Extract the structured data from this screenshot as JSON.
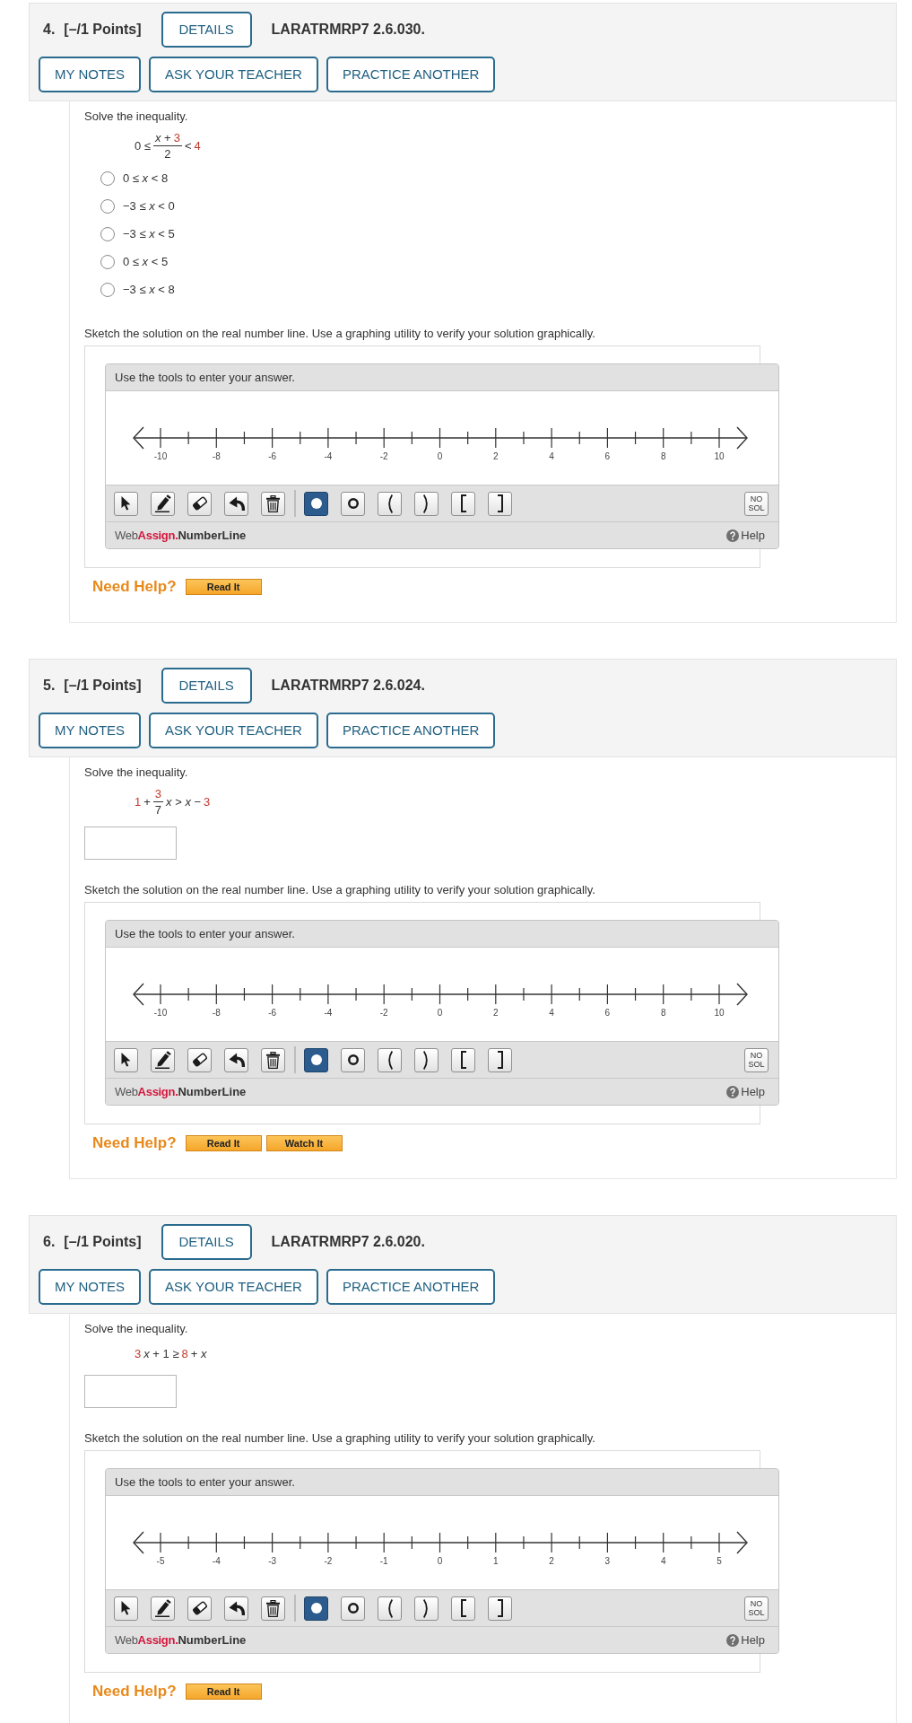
{
  "questions": [
    {
      "number": "4.",
      "points": "[–/1 Points]",
      "details_button": "DETAILS",
      "code": "LARATRMRP7 2.6.030.",
      "actions": [
        "MY NOTES",
        "ASK YOUR TEACHER",
        "PRACTICE ANOTHER"
      ],
      "instruction": "Solve the inequality.",
      "expression": [
        {
          "kind": "text",
          "text": "0 ≤"
        },
        {
          "kind": "fraction",
          "numerator": [
            {
              "kind": "text",
              "text": "*x* +"
            },
            {
              "kind": "highlight",
              "text": "3"
            }
          ],
          "denominator": [
            {
              "kind": "text",
              "text": "2"
            }
          ]
        },
        {
          "kind": "text",
          "text": "<"
        },
        {
          "kind": "highlight",
          "text": "4"
        }
      ],
      "answer": {
        "kind": "choices",
        "options": [
          {
            "text": "0 ≤ *x* < 8",
            "selected": false
          },
          {
            "text": "−3 ≤ *x* < 0",
            "selected": false
          },
          {
            "text": "−3 ≤ *x* < 5",
            "selected": false
          },
          {
            "text": "0 ≤ *x* < 5",
            "selected": false
          },
          {
            "text": "−3 ≤ *x* < 8",
            "selected": false
          }
        ]
      },
      "sketch_instruction": "Sketch the solution on the real number line. Use a graphing utility to verify your solution graphically.",
      "number_line": {
        "prompt": "Use the tools to enter your answer.",
        "tick_labels": [
          "-10",
          "-8",
          "-6",
          "-4",
          "-2",
          "0",
          "2",
          "4",
          "6",
          "8",
          "10"
        ],
        "edit_tools": [
          {
            "kind": "select",
            "selected": false
          },
          {
            "kind": "pencil",
            "selected": false
          },
          {
            "kind": "eraser",
            "selected": false
          },
          {
            "kind": "undo",
            "selected": false
          },
          {
            "kind": "trash",
            "selected": false
          }
        ],
        "marker_tools": [
          {
            "kind": "closed_dot",
            "selected": true
          },
          {
            "kind": "open_dot",
            "selected": false
          },
          {
            "kind": "left_paren",
            "selected": false
          },
          {
            "kind": "right_paren",
            "selected": false
          },
          {
            "kind": "left_bracket",
            "selected": false
          },
          {
            "kind": "right_bracket",
            "selected": false
          }
        ],
        "no_solution": "NO SOL",
        "logo": [
          {
            "kind": "light",
            "text": "Web"
          },
          {
            "kind": "accent",
            "text": "Assign"
          },
          {
            "kind": "accent",
            "text": "."
          },
          {
            "kind": "strong",
            "text": "NumberLine"
          }
        ],
        "help": "Help"
      },
      "need_help": {
        "label": "Need Help?",
        "buttons": [
          "Read It"
        ]
      }
    },
    {
      "number": "5.",
      "points": "[–/1 Points]",
      "details_button": "DETAILS",
      "code": "LARATRMRP7 2.6.024.",
      "actions": [
        "MY NOTES",
        "ASK YOUR TEACHER",
        "PRACTICE ANOTHER"
      ],
      "instruction": "Solve the inequality.",
      "expression": [
        {
          "kind": "highlight",
          "text": "1"
        },
        {
          "kind": "text",
          "text": "+"
        },
        {
          "kind": "fraction",
          "numerator": [
            {
              "kind": "highlight",
              "text": "3"
            }
          ],
          "denominator": [
            {
              "kind": "text",
              "text": "7"
            }
          ]
        },
        {
          "kind": "text",
          "text": "*x* > *x* −"
        },
        {
          "kind": "highlight",
          "text": "3"
        }
      ],
      "answer": {
        "kind": "input"
      },
      "sketch_instruction": "Sketch the solution on the real number line. Use a graphing utility to verify your solution graphically.",
      "number_line": {
        "prompt": "Use the tools to enter your answer.",
        "tick_labels": [
          "-10",
          "-8",
          "-6",
          "-4",
          "-2",
          "0",
          "2",
          "4",
          "6",
          "8",
          "10"
        ],
        "edit_tools": [
          {
            "kind": "select",
            "selected": false
          },
          {
            "kind": "pencil",
            "selected": false
          },
          {
            "kind": "eraser",
            "selected": false
          },
          {
            "kind": "undo",
            "selected": false
          },
          {
            "kind": "trash",
            "selected": false
          }
        ],
        "marker_tools": [
          {
            "kind": "closed_dot",
            "selected": true
          },
          {
            "kind": "open_dot",
            "selected": false
          },
          {
            "kind": "left_paren",
            "selected": false
          },
          {
            "kind": "right_paren",
            "selected": false
          },
          {
            "kind": "left_bracket",
            "selected": false
          },
          {
            "kind": "right_bracket",
            "selected": false
          }
        ],
        "no_solution": "NO SOL",
        "logo": [
          {
            "kind": "light",
            "text": "Web"
          },
          {
            "kind": "accent",
            "text": "Assign"
          },
          {
            "kind": "accent",
            "text": "."
          },
          {
            "kind": "strong",
            "text": "NumberLine"
          }
        ],
        "help": "Help"
      },
      "need_help": {
        "label": "Need Help?",
        "buttons": [
          "Read It",
          "Watch It"
        ]
      }
    },
    {
      "number": "6.",
      "points": "[–/1 Points]",
      "details_button": "DETAILS",
      "code": "LARATRMRP7 2.6.020.",
      "actions": [
        "MY NOTES",
        "ASK YOUR TEACHER",
        "PRACTICE ANOTHER"
      ],
      "instruction": "Solve the inequality.",
      "expression": [
        {
          "kind": "highlight",
          "text": "3"
        },
        {
          "kind": "text",
          "text": "*x* + 1 ≥"
        },
        {
          "kind": "highlight",
          "text": "8"
        },
        {
          "kind": "text",
          "text": "+ *x*"
        }
      ],
      "answer": {
        "kind": "input"
      },
      "sketch_instruction": "Sketch the solution on the real number line. Use a graphing utility to verify your solution graphically.",
      "number_line": {
        "prompt": "Use the tools to enter your answer.",
        "tick_labels": [
          "-5",
          "-4",
          "-3",
          "-2",
          "-1",
          "0",
          "1",
          "2",
          "3",
          "4",
          "5"
        ],
        "edit_tools": [
          {
            "kind": "select",
            "selected": false
          },
          {
            "kind": "pencil",
            "selected": false
          },
          {
            "kind": "eraser",
            "selected": false
          },
          {
            "kind": "undo",
            "selected": false
          },
          {
            "kind": "trash",
            "selected": false
          }
        ],
        "marker_tools": [
          {
            "kind": "closed_dot",
            "selected": true
          },
          {
            "kind": "open_dot",
            "selected": false
          },
          {
            "kind": "left_paren",
            "selected": false
          },
          {
            "kind": "right_paren",
            "selected": false
          },
          {
            "kind": "left_bracket",
            "selected": false
          },
          {
            "kind": "right_bracket",
            "selected": false
          }
        ],
        "no_solution": "NO SOL",
        "logo": [
          {
            "kind": "light",
            "text": "Web"
          },
          {
            "kind": "accent",
            "text": "Assign"
          },
          {
            "kind": "accent",
            "text": "."
          },
          {
            "kind": "strong",
            "text": "NumberLine"
          }
        ],
        "help": "Help"
      },
      "need_help": {
        "label": "Need Help?",
        "buttons": [
          "Read It"
        ]
      }
    }
  ]
}
